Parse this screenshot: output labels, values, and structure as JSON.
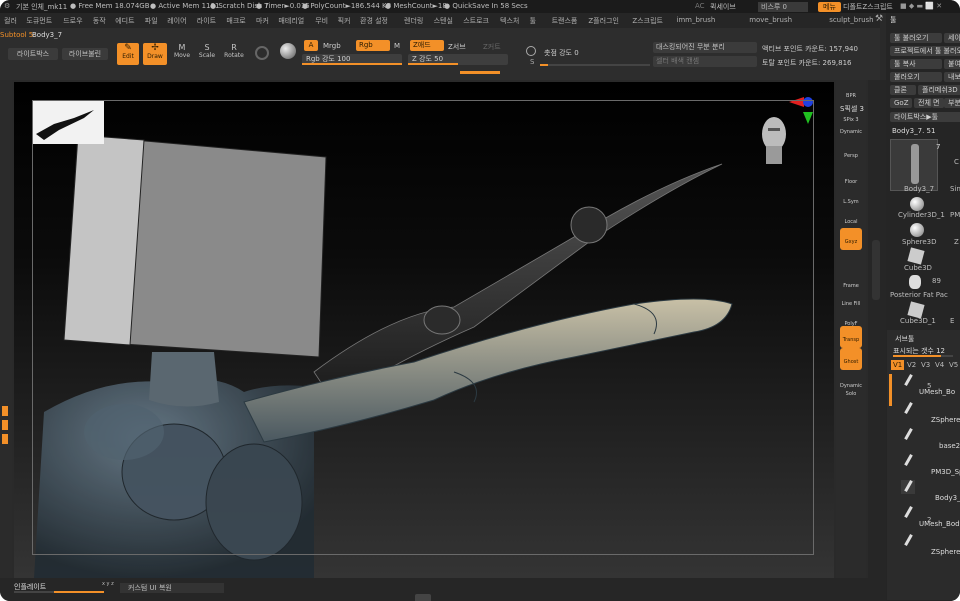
{
  "titlebar": {
    "app_title": "기본 인체_mk11",
    "free_mem": "● Free Mem 18.074GB",
    "active_mem": "● Active Mem 1181",
    "scratch": "● Scratch Disk 7",
    "timer": "● Timer►0.015",
    "polycount": "● PolyCount►186.544 KP",
    "meshcount": "● MeshCount►18",
    "quicksave": "● QuickSave In 58 Secs",
    "ac": "AC",
    "quicksave_label": "퀵세이브",
    "transparency": "비스루 0",
    "menus_btn": "메뉴",
    "default_script": "디폴트Z스크립트"
  },
  "menu_items": [
    "컬러",
    "도큐먼트",
    "드로우",
    "동작",
    "에디트",
    "파일",
    "레이어",
    "라이트",
    "매크로",
    "마커",
    "매테리얼",
    "무비",
    "픽커",
    "환경 설정",
    "렌더링",
    "스텐실",
    "스트로크",
    "텍스처",
    "툴",
    "트랜스폼",
    "Z플러그인",
    "Z스크립트",
    "imm_brush",
    "move_brush",
    "sculpt_brush",
    "도움말"
  ],
  "toolbar": {
    "subtool_label": "Subtool 5:",
    "subtool_name": "Body3_7",
    "lightbox": "라이트박스",
    "live_boolean": "라이브불린",
    "edit": "Edit",
    "draw": "Draw",
    "move": "Move",
    "scale": "Scale",
    "rotate": "Rotate",
    "a_btn": "A",
    "mrgb": "Mrgb",
    "rgb": "Rgb",
    "m_btn": "M",
    "zadd": "Z애드",
    "zsub": "Z서브",
    "zcut": "Z커트",
    "rgb_intensity": "Rgb 강도 100",
    "z_intensity": "Z 강도 50",
    "focal_shift": "촛점 강도 0",
    "s_label": "S",
    "dynamesh_label": "대스킹되어진 무분 분리",
    "background_label": "셀터 배색 캔셈",
    "active_points": "액티브 포인트 카운트: 157,940",
    "total_points": "토탈 포인트 카운트: 269,816"
  },
  "right_tools": [
    "BPR",
    "SPix 3",
    "Dynamic",
    "Persp",
    "Floor",
    "L.Sym",
    "Local",
    "Gxyz",
    "Frame",
    "Line Fill",
    "PolyF",
    "Transp",
    "Ghost",
    "Dynamic Solo"
  ],
  "right_tools_spix": "S픽셀 3",
  "tool_panel": {
    "header": "툴",
    "load_tool": "툴 불러오기",
    "save_as": "세이",
    "import": "프로젝트에서 툴 불러오",
    "copy_tool": "툴 복사",
    "paste": "붙여",
    "load": "불러오기",
    "export": "내보",
    "clone": "클론",
    "polymesh3d": "폴리메쉬3D 만",
    "goz": "GoZ",
    "all": "전체",
    "visible": "면",
    "partial": "부분",
    "lightbox_tool": "라이트박스▶툴",
    "current_tool": "Body3_7. 51",
    "count": "7",
    "items": [
      "Body3_7",
      "Cylinder3D_1",
      "Sphere3D",
      "Cube3D",
      "Posterior Fat Pac",
      "Cube3D_1"
    ],
    "count89": "89",
    "extra": [
      "Sin",
      "PM",
      "Z",
      "C",
      "E"
    ]
  },
  "subtool_panel": {
    "header": "서브툴",
    "visible_count_label": "표시되는 갯수 12",
    "tabs": [
      "V1",
      "V2",
      "V3",
      "V4",
      "V5"
    ],
    "items": [
      "UMesh_Bo",
      "ZSphere",
      "base2",
      "PM3D_Sphe",
      "Body3_",
      "UMesh_Body",
      "ZSphere"
    ],
    "num5": "5",
    "num2": "2"
  },
  "bottom": {
    "inflate": "인플레이트",
    "xyz": "x y z",
    "custom_ui": "커스텀 UI 복원"
  },
  "colors": {
    "accent": "#f39028",
    "bg": "#2a2a2a",
    "axis_red": "#e02020",
    "axis_green": "#20c020",
    "axis_blue": "#2040e0"
  }
}
